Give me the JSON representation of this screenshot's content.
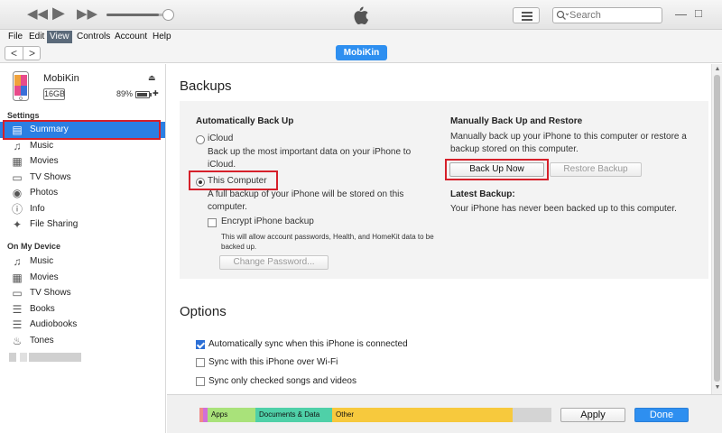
{
  "titlebar": {
    "search_placeholder": "Search",
    "icons": [
      "rewind-icon",
      "play-icon",
      "fast-forward-icon",
      "apple-logo-icon",
      "list-view-icon",
      "search-icon"
    ],
    "volume": 0.85
  },
  "menu": {
    "items": [
      {
        "label": "File",
        "active": false
      },
      {
        "label": "Edit",
        "active": false
      },
      {
        "label": "View",
        "active": true
      },
      {
        "label": "Controls",
        "active": false
      },
      {
        "label": "Account",
        "active": false
      },
      {
        "label": "Help",
        "active": false
      }
    ]
  },
  "nav": {
    "back": "<",
    "forward": ">",
    "device_pill": "MobiKin"
  },
  "device": {
    "name": "MobiKin",
    "capacity": "16GB",
    "battery": "89%",
    "battery_level": 0.89
  },
  "sidebar": {
    "settings_label": "Settings",
    "settings_items": [
      {
        "label": "Summary",
        "icon": "summary-icon",
        "selected": true
      },
      {
        "label": "Music",
        "icon": "music-note-icon",
        "selected": false
      },
      {
        "label": "Movies",
        "icon": "film-icon",
        "selected": false
      },
      {
        "label": "TV Shows",
        "icon": "tv-icon",
        "selected": false
      },
      {
        "label": "Photos",
        "icon": "camera-icon",
        "selected": false
      },
      {
        "label": "Info",
        "icon": "info-icon",
        "selected": false
      },
      {
        "label": "File Sharing",
        "icon": "apps-icon",
        "selected": false
      }
    ],
    "device_label": "On My Device",
    "device_items": [
      {
        "label": "Music",
        "icon": "music-note-icon"
      },
      {
        "label": "Movies",
        "icon": "film-icon"
      },
      {
        "label": "TV Shows",
        "icon": "tv-icon"
      },
      {
        "label": "Books",
        "icon": "book-icon"
      },
      {
        "label": "Audiobooks",
        "icon": "audiobook-icon"
      },
      {
        "label": "Tones",
        "icon": "bell-icon"
      }
    ]
  },
  "backups": {
    "title": "Backups",
    "auto_heading": "Automatically Back Up",
    "icloud_label": "iCloud",
    "icloud_desc_1": "Back up the most important data on your iPhone to",
    "icloud_desc_2": "iCloud.",
    "computer_label": "This Computer",
    "computer_desc_1": "A full backup of your iPhone will be stored on this",
    "computer_desc_2": "computer.",
    "encrypt_label": "Encrypt iPhone backup",
    "encrypt_desc_1": "This will allow account passwords, Health, and HomeKit data to be",
    "encrypt_desc_2": "backed up.",
    "change_password": "Change Password...",
    "manual_heading": "Manually Back Up and Restore",
    "manual_desc_1": "Manually back up your iPhone to this computer or restore a",
    "manual_desc_2": "backup stored on this computer.",
    "backup_now": "Back Up Now",
    "restore_backup": "Restore Backup",
    "latest_heading": "Latest Backup:",
    "latest_desc": "Your iPhone has never been backed up to this computer."
  },
  "options": {
    "title": "Options",
    "items": [
      {
        "label": "Automatically sync when this iPhone is connected",
        "checked": true
      },
      {
        "label": "Sync with this iPhone over Wi-Fi",
        "checked": false
      },
      {
        "label": "Sync only checked songs and videos",
        "checked": false
      }
    ]
  },
  "storage": {
    "segments": [
      {
        "label": "",
        "color": "#f08a8a"
      },
      {
        "label": "",
        "color": "#d26fd8"
      },
      {
        "label": "Apps",
        "color": "#a9e27a"
      },
      {
        "label": "Documents & Data",
        "color": "#4fd0a8"
      },
      {
        "label": "Other",
        "color": "#f7c93d"
      },
      {
        "label": "",
        "color": "#d4d4d4"
      }
    ]
  },
  "footer": {
    "apply": "Apply",
    "done": "Done"
  },
  "colors": {
    "accent": "#2e8ff0",
    "selection": "#2b7fe3",
    "highlight_box": "#d6202a"
  }
}
